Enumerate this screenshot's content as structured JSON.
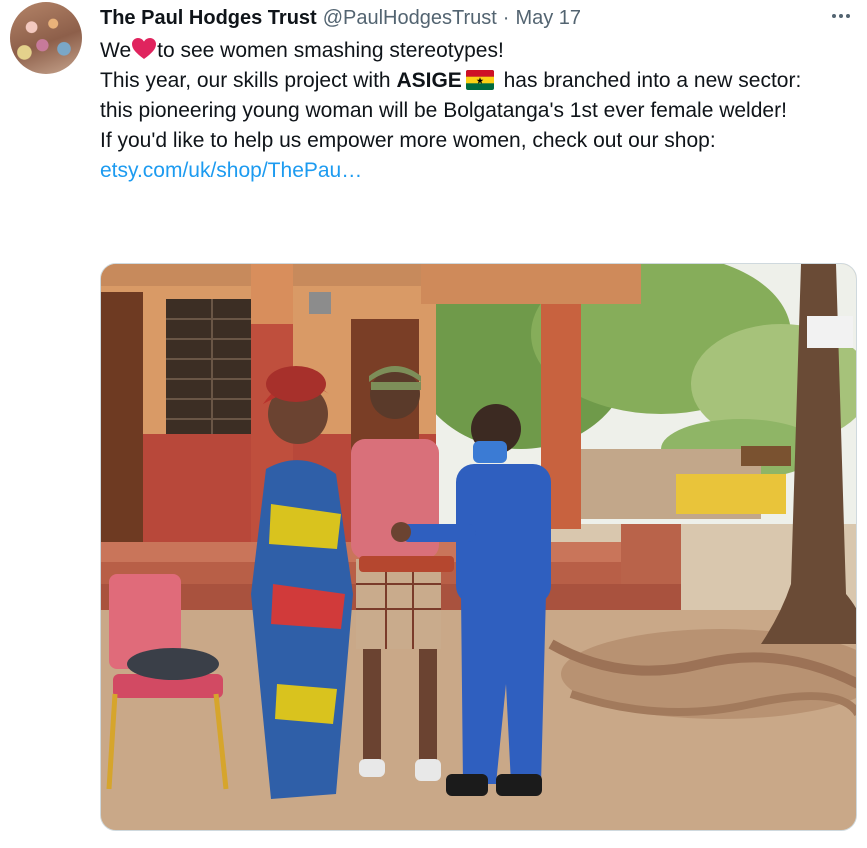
{
  "tweet": {
    "author_name": "The Paul Hodges Trust",
    "author_handle": "@PaulHodgesTrust",
    "separator": "·",
    "date": "May 17",
    "text": {
      "line1_before_heart": "We",
      "line1_after_heart": "to see women smashing stereotypes!",
      "line2_before_bold": "This year, our skills project with ",
      "line2_bold": "ASIGE",
      "line2_after_flag": " has branched into a new sector:",
      "line3": "this pioneering young woman will be Bolgatanga's 1st ever female welder!",
      "line4": "If you'd like to help us empower more women, check out our shop:",
      "link_text": "etsy.com/uk/shop/ThePau…"
    },
    "icons": {
      "more": "more-horizontal-icon",
      "heart": "red-heart-emoji",
      "flag": "ghana-flag-emoji"
    },
    "colors": {
      "link": "#1d9bf0",
      "secondary_text": "#536471",
      "primary_text": "#0f1419",
      "heart": "#e0245e"
    }
  }
}
